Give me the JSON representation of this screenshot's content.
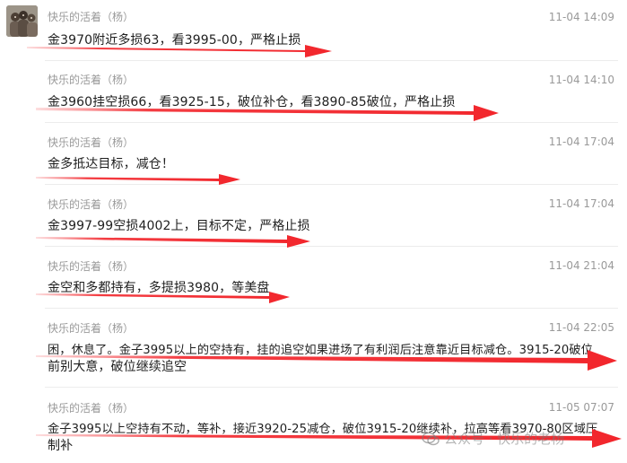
{
  "chat": {
    "messages": [
      {
        "sender": "快乐的活着（杨）",
        "time": "11-04 14:09",
        "line1": "金3970附近多损63，看3995-00，严格止损",
        "line2": ""
      },
      {
        "sender": "快乐的活着（杨）",
        "time": "11-04 14:10",
        "line1": "金3960挂空损66，看3925-15，破位补仓，看3890-85破位，严格止损",
        "line2": ""
      },
      {
        "sender": "快乐的活着（杨）",
        "time": "11-04 17:04",
        "line1": "金多抵达目标，减仓！",
        "line2": ""
      },
      {
        "sender": "快乐的活着（杨）",
        "time": "11-04 17:04",
        "line1": "金3997-99空损4002上，目标不定，严格止损",
        "line2": ""
      },
      {
        "sender": "快乐的活着（杨）",
        "time": "11-04 21:04",
        "line1": "金空和多都持有，多提损3980，等美盘",
        "line2": ""
      },
      {
        "sender": "快乐的活着（杨）",
        "time": "11-04 22:05",
        "line1": "困，休息了。金子3995以上的空持有，挂的追空如果进场了有利润后注意靠近目标减仓。3915-20破位",
        "line2": "前别大意，破位继续追空"
      },
      {
        "sender": "快乐的活着（杨）",
        "time": "11-05 07:07",
        "line1": "金子3995以上空持有不动，等补，接近3920-25减仓，破位3915-20继续补，拉高等看3970-80区域压",
        "line2": "制补"
      }
    ]
  },
  "watermark": {
    "text": "公众号 · 快乐的老杨",
    "icon": "wechat-official-account-icon"
  },
  "colors": {
    "arrow": "#f2262c",
    "meta_text": "#9a9a9a",
    "body_text": "#1f1f1f",
    "separator": "#ececec"
  }
}
